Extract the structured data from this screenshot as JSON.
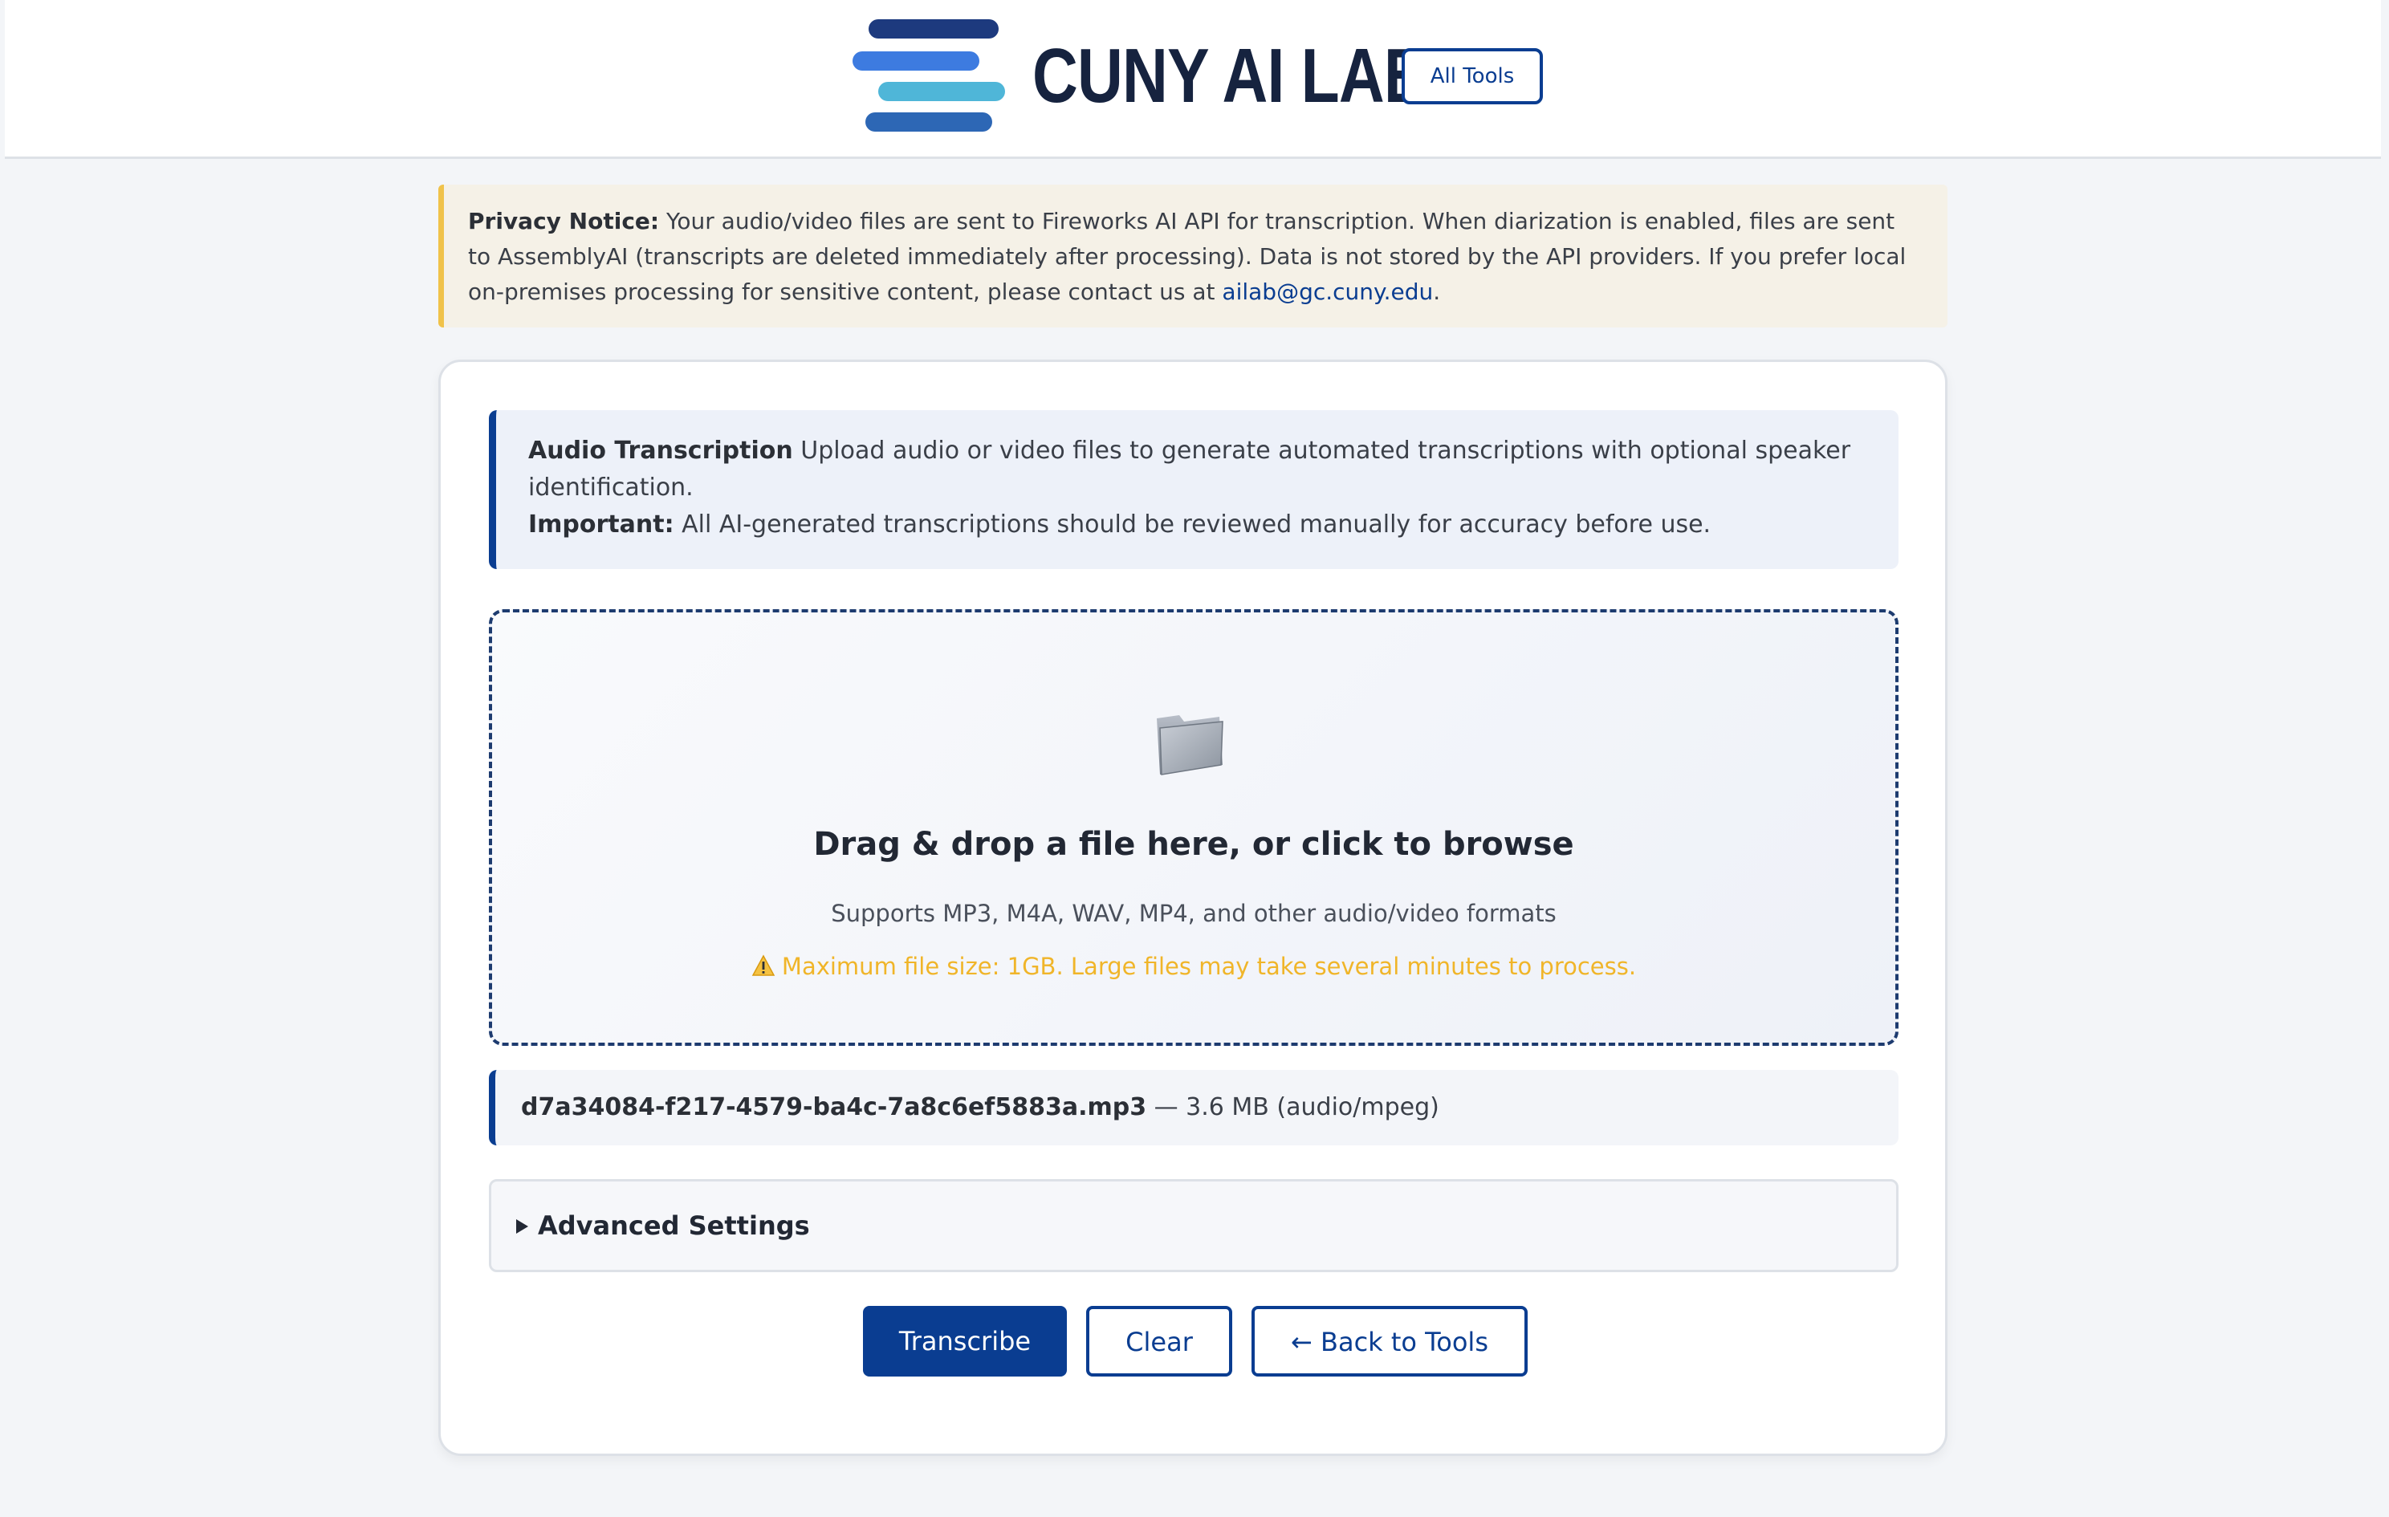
{
  "header": {
    "logo_text": "CUNY AI LAB",
    "all_tools_label": "All Tools"
  },
  "privacy": {
    "label": "Privacy Notice:",
    "text": " Your audio/video files are sent to Fireworks AI API for transcription. When diarization is enabled, files are sent to AssemblyAI (transcripts are deleted immediately after processing). Data is not stored by the API providers. If you prefer local on-premises processing for sensitive content, please contact us at ",
    "email": "ailab@gc.cuny.edu",
    "end": "."
  },
  "intro": {
    "title": "Audio Transcription",
    "description": " Upload audio or video files to generate automated transcriptions with optional speaker identification.",
    "important_label": "Important:",
    "important_text": " All AI-generated transcriptions should be reviewed manually for accuracy before use."
  },
  "dropzone": {
    "icon": "folder-icon",
    "title": "Drag & drop a file here, or click to browse",
    "formats": "Supports MP3, M4A, WAV, MP4, and other audio/video formats",
    "warning_icon": "warning-icon",
    "warning": "Maximum file size: 1GB. Large files may take several minutes to process."
  },
  "file": {
    "name": "d7a34084-f217-4579-ba4c-7a8c6ef5883a.mp3",
    "meta": " — 3.6 MB (audio/mpeg)"
  },
  "advanced": {
    "label": "Advanced Settings"
  },
  "actions": {
    "transcribe": "Transcribe",
    "clear": "Clear",
    "back": "← Back to Tools"
  },
  "colors": {
    "brand": "#0a3d91",
    "logo_navy": "#1d3a7e",
    "logo_blue": "#3d7be0",
    "logo_cyan": "#4fb6d8",
    "logo_mid": "#2d67b5",
    "warning": "#f0b529",
    "notice_border": "#f0c24a"
  }
}
